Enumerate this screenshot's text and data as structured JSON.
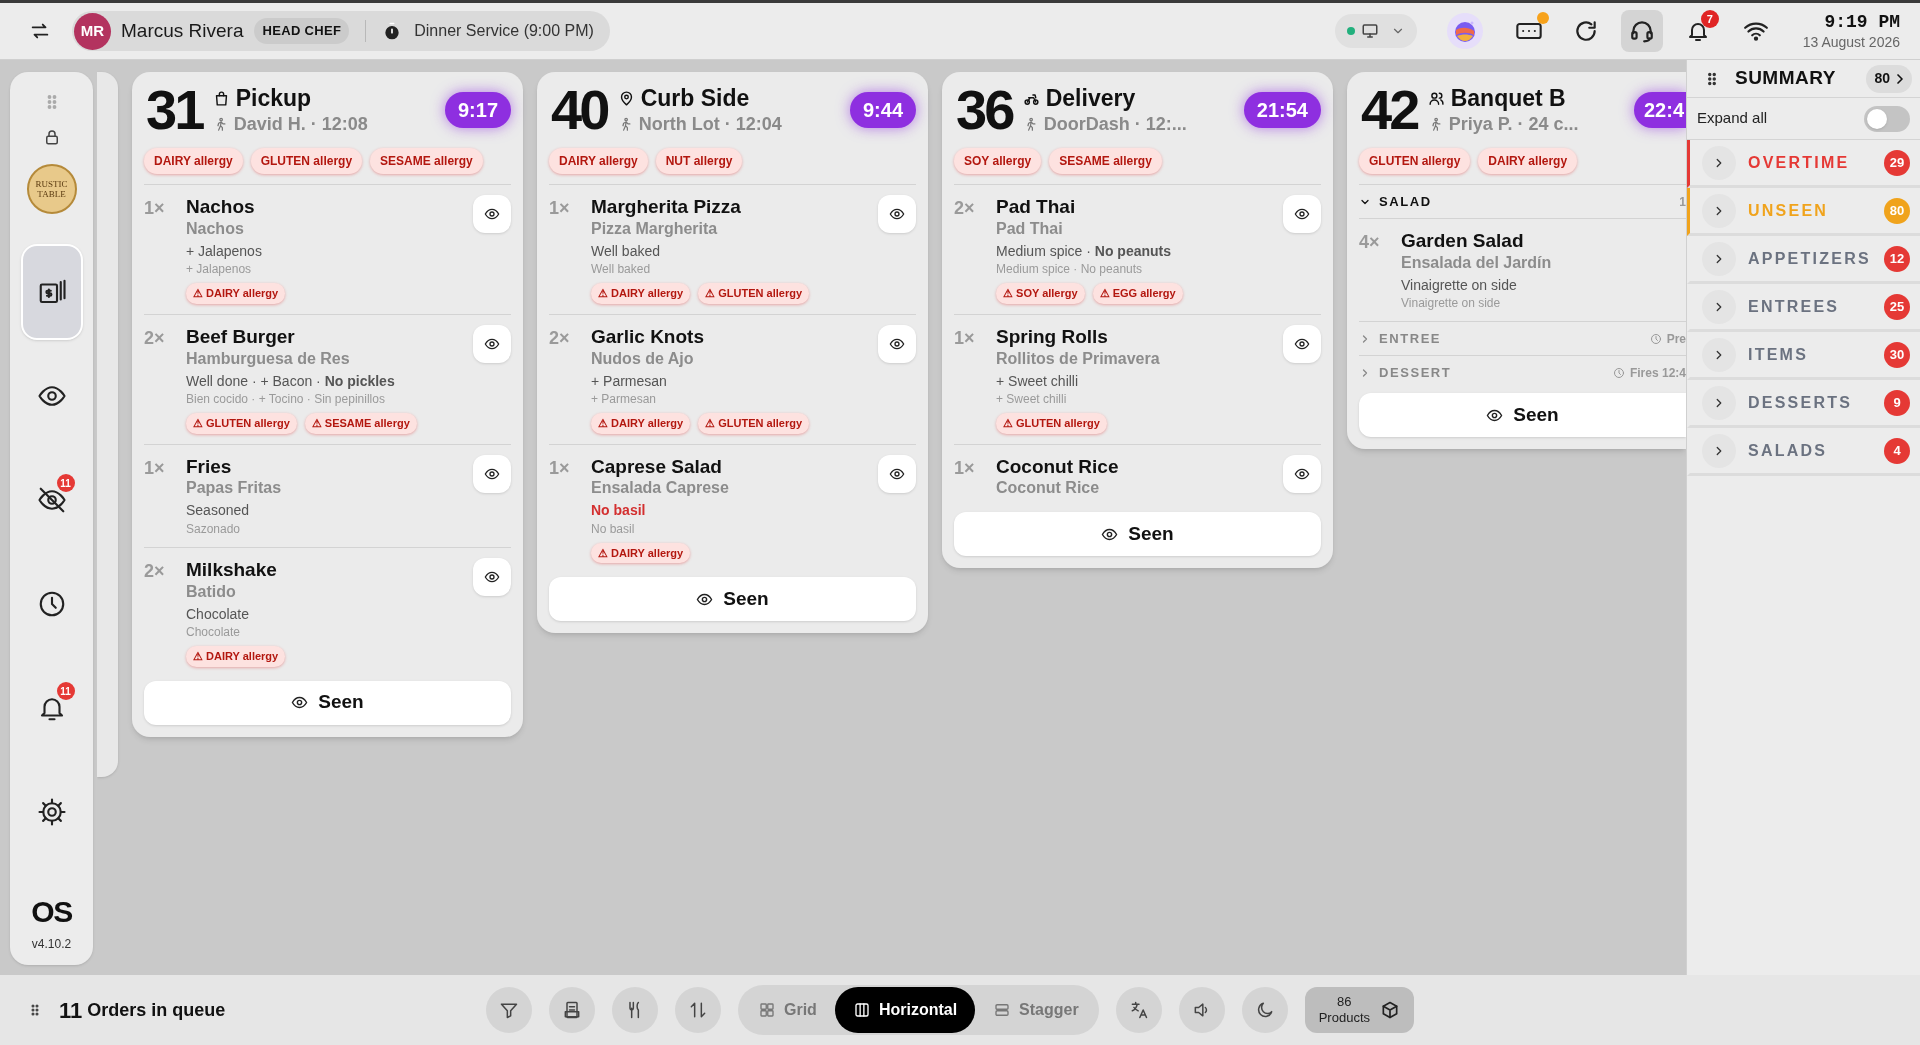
{
  "top_bar": {
    "user": {
      "initials": "MR",
      "name": "Marcus Rivera",
      "role": "HEAD CHEF"
    },
    "service": "Dinner Service (9:00 PM)",
    "status_online": true,
    "keyboard_alert": true,
    "headset_selected": true,
    "notifications": "7",
    "time": "9:19 PM",
    "date": "13 August 2026"
  },
  "sidebar": {
    "logo": [
      "RUSTIC",
      "TABLE"
    ],
    "items": [
      {
        "selected": true
      },
      {
        "selected": false
      },
      {
        "selected": false,
        "badge": "11"
      },
      {
        "selected": false
      },
      {
        "selected": false,
        "badge": "11"
      },
      {
        "selected": false
      }
    ],
    "brand": "OS",
    "version": "v4.10.2"
  },
  "orders": [
    {
      "number": "31",
      "kind": "pickup",
      "type_label": "Pickup",
      "subtitle": "David H. · 12:08",
      "timer": "9:17",
      "allergies": [
        "DAIRY allergy",
        "GLUTEN allergy",
        "SESAME allergy"
      ],
      "courses": [
        {
          "items": [
            {
              "qty": "1×",
              "name": "Nachos",
              "translation": "Nachos",
              "mods": "+ Jalapenos",
              "mods_translation": "+ Jalapenos",
              "allergies": [
                "⚠ DAIRY allergy"
              ]
            },
            {
              "qty": "2×",
              "name": "Beef Burger",
              "translation": "Hamburguesa de Res",
              "mods": "Well done · + Bacon · **No pickles**",
              "mods_translation": "Bien cocido · + Tocino · Sin pepinillos",
              "allergies": [
                "⚠ GLUTEN allergy",
                "⚠ SESAME allergy"
              ]
            },
            {
              "qty": "1×",
              "name": "Fries",
              "translation": "Papas Fritas",
              "mods": "Seasoned",
              "mods_translation": "Sazonado"
            },
            {
              "qty": "2×",
              "name": "Milkshake",
              "translation": "Batido",
              "mods": "Chocolate",
              "mods_translation": "Chocolate",
              "allergies": [
                "⚠ DAIRY allergy"
              ]
            }
          ]
        }
      ],
      "seen_label": "Seen"
    },
    {
      "number": "40",
      "kind": "curbside",
      "type_label": "Curb Side",
      "subtitle": "North Lot · 12:04",
      "timer": "9:44",
      "allergies": [
        "DAIRY allergy",
        "NUT allergy"
      ],
      "courses": [
        {
          "items": [
            {
              "qty": "1×",
              "name": "Margherita Pizza",
              "translation": "Pizza Margherita",
              "mods": "Well baked",
              "mods_translation": "Well baked",
              "allergies": [
                "⚠ DAIRY allergy",
                "⚠ GLUTEN allergy"
              ]
            },
            {
              "qty": "2×",
              "name": "Garlic Knots",
              "translation": "Nudos de Ajo",
              "mods": "+ Parmesan",
              "mods_translation": "+ Parmesan",
              "allergies": [
                "⚠ DAIRY allergy",
                "⚠ GLUTEN allergy"
              ]
            },
            {
              "qty": "1×",
              "name": "Caprese Salad",
              "translation": "Ensalada Caprese",
              "mods": "No basil",
              "mods_alert": true,
              "mods_translation": "No basil",
              "allergies": [
                "⚠ DAIRY allergy"
              ]
            }
          ]
        }
      ],
      "seen_label": "Seen"
    },
    {
      "number": "36",
      "kind": "delivery",
      "type_label": "Delivery",
      "subtitle": "DoorDash · 12:...",
      "timer": "21:54",
      "allergies": [
        "SOY allergy",
        "SESAME allergy"
      ],
      "courses": [
        {
          "items": [
            {
              "qty": "2×",
              "name": "Pad Thai",
              "translation": "Pad Thai",
              "mods": "Medium spice · **No peanuts**",
              "mods_translation": "Medium spice · No peanuts",
              "allergies": [
                "⚠ SOY allergy",
                "⚠ EGG allergy"
              ]
            },
            {
              "qty": "1×",
              "name": "Spring Rolls",
              "translation": "Rollitos de Primavera",
              "mods": "+ Sweet chilli",
              "mods_translation": "+ Sweet chilli",
              "allergies": [
                "⚠ GLUTEN allergy"
              ]
            },
            {
              "qty": "1×",
              "name": "Coconut Rice",
              "translation": "Coconut Rice"
            }
          ]
        }
      ],
      "seen_label": "Seen"
    },
    {
      "number": "42",
      "kind": "banquet",
      "type_label": "Banquet B",
      "subtitle": "Priya P. · 24 c...",
      "timer": "22:4",
      "allergies": [
        "GLUTEN allergy",
        "DAIRY allergy"
      ],
      "courses": [
        {
          "name": "SALAD",
          "expanded": true,
          "note": "1",
          "note_clock": false,
          "items": [
            {
              "qty": "4×",
              "name": "Garden Salad",
              "translation": "Ensalada del Jardín",
              "mods": "Vinaigrette on side",
              "mods_translation": "Vinaigrette on side"
            }
          ]
        },
        {
          "name": "ENTREE",
          "expanded": false,
          "note": "Pre",
          "note_clock": true
        },
        {
          "name": "DESSERT",
          "expanded": false,
          "note": "Fires 12:4",
          "note_clock": true
        }
      ],
      "seen_label": "Seen"
    }
  ],
  "summary": {
    "title": "SUMMARY",
    "total": "80",
    "expand_all": {
      "label": "Expand all",
      "on": false
    },
    "categories": [
      {
        "label": "OVERTIME",
        "count": "29",
        "color": "#e53935",
        "highlighted": true
      },
      {
        "label": "UNSEEN",
        "count": "80",
        "color": "#f0a31c",
        "highlighted": true
      },
      {
        "label": "APPETIZERS",
        "count": "12",
        "color": "#e53935",
        "highlighted": false
      },
      {
        "label": "ENTREES",
        "count": "25",
        "color": "#e53935",
        "highlighted": false
      },
      {
        "label": "ITEMS",
        "count": "30",
        "color": "#e53935",
        "highlighted": false
      },
      {
        "label": "DESSERTS",
        "count": "9",
        "color": "#e53935",
        "highlighted": false
      },
      {
        "label": "SALADS",
        "count": "4",
        "color": "#e53935",
        "highlighted": false
      }
    ]
  },
  "bottom_bar": {
    "queue_count": "11",
    "queue_label": "Orders in queue",
    "views": [
      {
        "label": "Grid",
        "selected": false
      },
      {
        "label": "Horizontal",
        "selected": true
      },
      {
        "label": "Stagger",
        "selected": false
      }
    ],
    "products": {
      "count": "86",
      "label": "Products"
    }
  }
}
